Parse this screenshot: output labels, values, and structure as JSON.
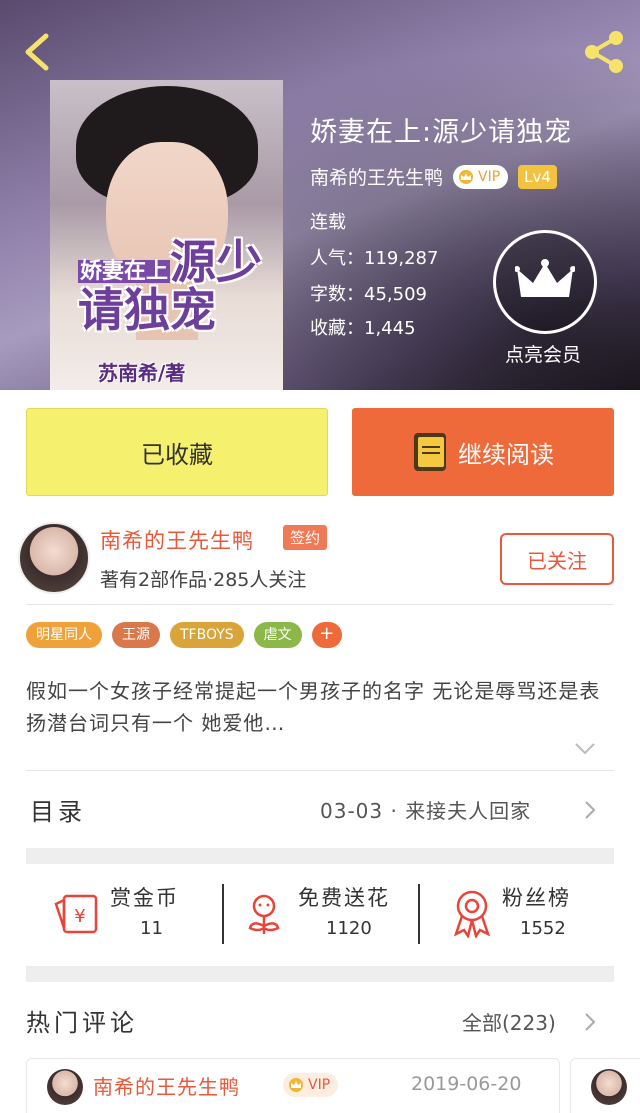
{
  "book": {
    "title": "娇妻在上:源少请独宠",
    "author": "南希的王先生鸭",
    "vip_label": "VIP",
    "level": "Lv4",
    "status": "连载",
    "popularity": "人气：119,287",
    "word_count": "字数：45,509",
    "favorites": "收藏：1,445",
    "member_label": "点亮会员",
    "cover": {
      "title_line1": "娇妻在上",
      "title_line2": "源少",
      "title_line3": "请独宠",
      "author_line": "苏南希/著"
    }
  },
  "actions": {
    "collected_label": "已收藏",
    "read_label": "继续阅读"
  },
  "author": {
    "name": "南希的王先生鸭",
    "sign_badge": "签约",
    "info": "著有2部作品·285人关注",
    "follow_label": "已关注"
  },
  "tags": [
    {
      "label": "明星同人",
      "color": "#f0a23a"
    },
    {
      "label": "王源",
      "color": "#d9784a"
    },
    {
      "label": "TFBOYS",
      "color": "#d9a43a"
    },
    {
      "label": "虐文",
      "color": "#8cb84a"
    }
  ],
  "tag_more": "+",
  "description": "假如一个女孩子经常提起一个男孩子的名字 无论是辱骂还是表扬潜台词只有一个 她爱他…",
  "toc": {
    "label": "目录",
    "latest": "03-03 · 来接夫人回家"
  },
  "stats": [
    {
      "label": "赏金币",
      "value": "11",
      "icon": "red-envelope-icon"
    },
    {
      "label": "免费送花",
      "value": "1120",
      "icon": "flower-icon"
    },
    {
      "label": "粉丝榜",
      "value": "1552",
      "icon": "award-ribbon-icon"
    }
  ],
  "comments": {
    "label": "热门评论",
    "all_label": "全部(223)",
    "items": [
      {
        "name": "南希的王先生鸭",
        "vip": "VIP",
        "date": "2019-06-20"
      }
    ]
  },
  "colors": {
    "accent": "#ef6a3a",
    "collected_bg": "#f5f06e",
    "author_red": "#e8583a"
  }
}
